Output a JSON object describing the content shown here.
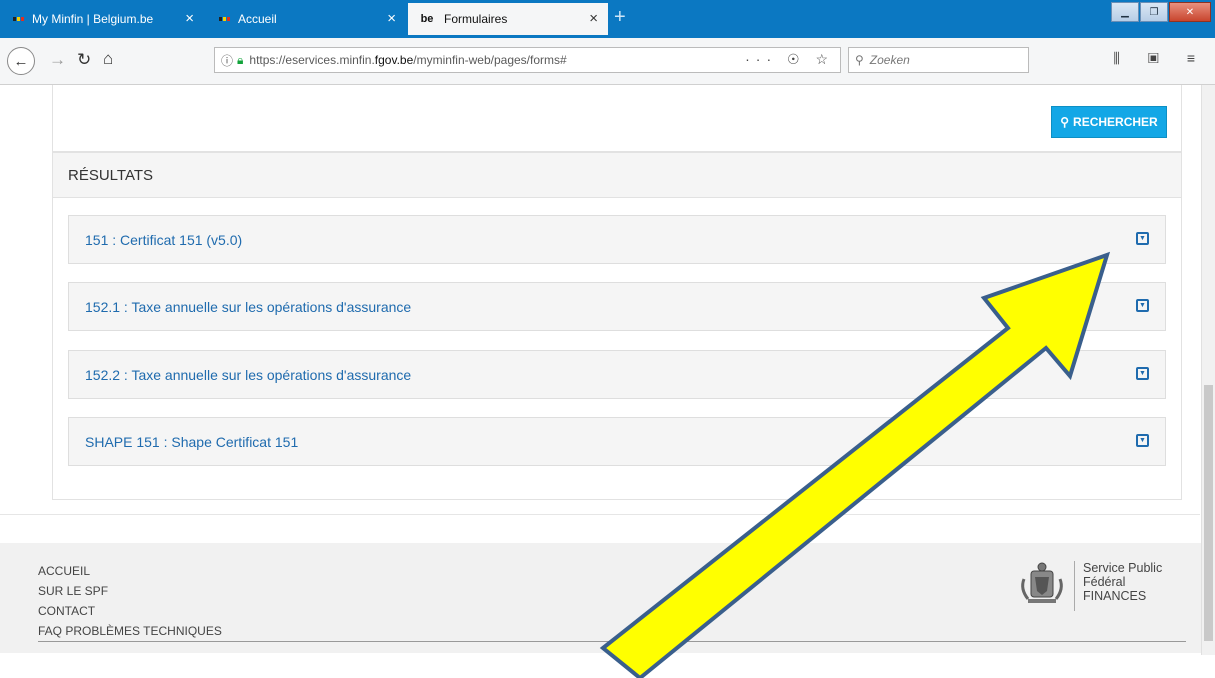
{
  "browser": {
    "tabs": [
      {
        "label": "My Minfin | Belgium.be",
        "close": "×"
      },
      {
        "label": "Accueil",
        "close": "×"
      },
      {
        "label": "Formulaires",
        "fav": "be",
        "close": "×"
      }
    ],
    "new_tab": "+",
    "url_prefix": "https://eservices.minfin.",
    "url_domain": "fgov.be",
    "url_path": "/myminfin-web/pages/forms#",
    "search_placeholder": "Zoeken",
    "url_tools": "··· ☉ ☆",
    "right_tools": "⫼ ▣ ≡"
  },
  "search_button": "RECHERCHER",
  "results": {
    "heading": "RÉSULTATS",
    "items": [
      {
        "label": "151 : Certificat 151 (v5.0)"
      },
      {
        "label": "152.1 : Taxe annuelle sur les opérations d'assurance"
      },
      {
        "label": "152.2 : Taxe annuelle sur les opérations d'assurance"
      },
      {
        "label": "SHAPE 151 : Shape Certificat 151"
      }
    ]
  },
  "footer": {
    "links": [
      "ACCUEIL",
      "SUR LE SPF",
      "CONTACT",
      "FAQ PROBLÈMES TECHNIQUES"
    ],
    "org_lines": [
      "Service Public",
      "Fédéral",
      "FINANCES"
    ]
  },
  "colors": {
    "accent": "#13a7e6",
    "link": "#1f6bae",
    "arrow_fill": "#ffff00",
    "arrow_stroke": "#3a5f8c"
  }
}
